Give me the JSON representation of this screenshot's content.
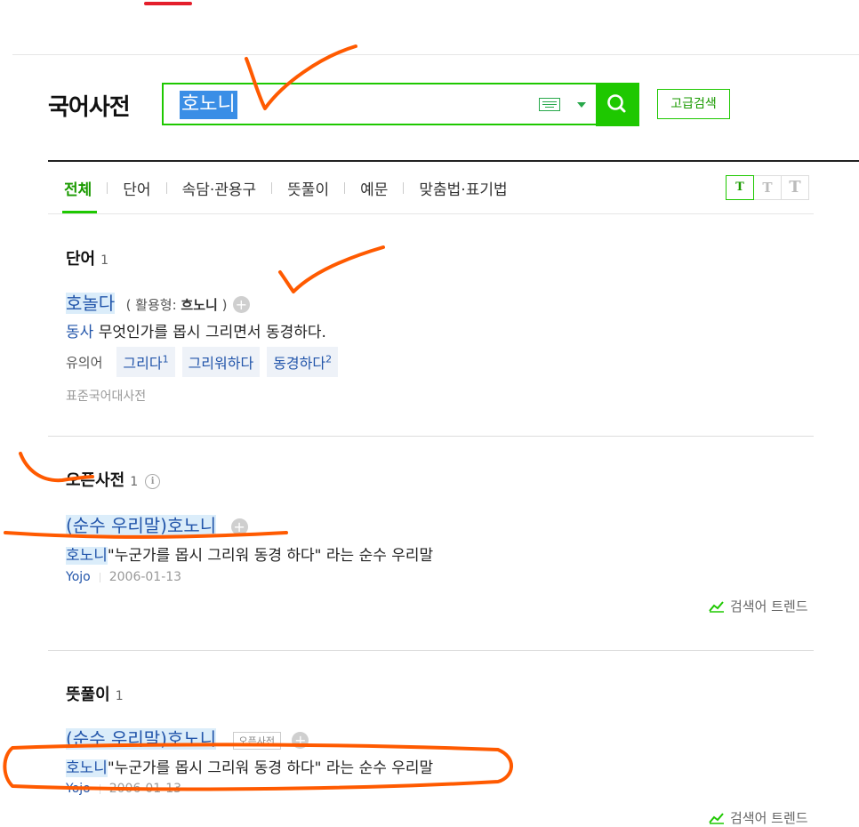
{
  "header": {
    "logo": "국어사전",
    "search": {
      "value": "호노니",
      "placeholder": ""
    },
    "keyboard_icon": "keyboard-icon",
    "search_icon": "search-icon",
    "advanced_search": "고급검색"
  },
  "tabs": [
    {
      "label": "전체",
      "active": true
    },
    {
      "label": "단어"
    },
    {
      "label": "속담·관용구"
    },
    {
      "label": "뜻풀이"
    },
    {
      "label": "예문"
    },
    {
      "label": "맞춤법·표기법"
    }
  ],
  "font_size_buttons": [
    "T",
    "T",
    "T"
  ],
  "sections": {
    "word": {
      "title": "단어",
      "count": "1",
      "entry": {
        "headword": "호놀다",
        "conj_open": "( 활용형: ",
        "conj_word": "흐노니",
        "conj_close": " )",
        "pos": "동사",
        "definition": "무엇인가를 몹시 그리면서 동경하다.",
        "synonym_label": "유의어",
        "synonyms": [
          {
            "word": "그리다",
            "sup": "1"
          },
          {
            "word": "그리워하다",
            "sup": ""
          },
          {
            "word": "동경하다",
            "sup": "2"
          }
        ],
        "source": "표준국어대사전"
      }
    },
    "open": {
      "title": "오픈사전",
      "count": "1",
      "entry": {
        "prefix": "(순수 우리말)",
        "headword": "호노니",
        "def_word": "호노니",
        "definition": "\"누군가를 몹시 그리워 동경 하다\" 라는 순수 우리말",
        "author": "Yojo",
        "date": "2006-01-13"
      },
      "trend": "검색어 트렌드"
    },
    "meaning": {
      "title": "뜻풀이",
      "count": "1",
      "entry": {
        "prefix": "(순수 우리말)",
        "headword": "호노니",
        "badge": "오픈사전",
        "def_word": "호노니",
        "definition": "\"누군가를 몹시 그리워 동경 하다\" 라는 순수 우리말",
        "author": "Yojo",
        "date": "2006-01-13"
      },
      "trend": "검색어 트렌드"
    }
  },
  "colors": {
    "accent_green": "#1ec800",
    "link_blue": "#2255aa",
    "annotation_orange": "#ff5a00",
    "highlight": "#dbedfa"
  }
}
